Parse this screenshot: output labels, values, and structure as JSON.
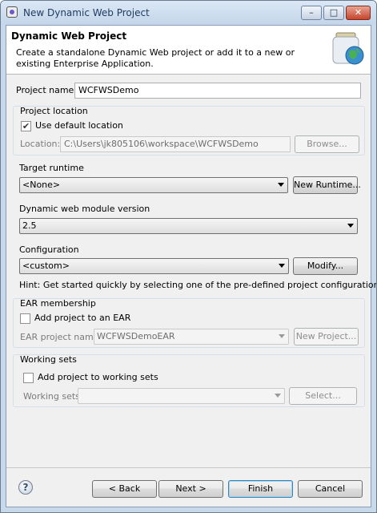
{
  "window": {
    "title": "New Dynamic Web Project"
  },
  "banner": {
    "title": "Dynamic Web Project",
    "description": "Create a standalone Dynamic Web project or add it to a new or existing Enterprise Application."
  },
  "project_name": {
    "label": "Project name:",
    "value": "WCFWSDemo"
  },
  "project_location": {
    "group_label": "Project location",
    "use_default_label": "Use default location",
    "use_default_checked": true,
    "location_label": "Location:",
    "location_value": "C:\\Users\\jk805106\\workspace\\WCFWSDemo",
    "browse_label": "Browse..."
  },
  "target_runtime": {
    "label": "Target runtime",
    "value": "<None>",
    "new_runtime_label": "New Runtime..."
  },
  "module_version": {
    "label": "Dynamic web module version",
    "value": "2.5"
  },
  "configuration": {
    "label": "Configuration",
    "value": "<custom>",
    "modify_label": "Modify...",
    "hint": "Hint: Get started quickly by selecting one of the pre-defined project configurations."
  },
  "ear": {
    "group_label": "EAR membership",
    "add_label": "Add project to an EAR",
    "add_checked": false,
    "project_name_label": "EAR project name:",
    "project_name_value": "WCFWSDemoEAR",
    "new_project_label": "New Project..."
  },
  "working_sets": {
    "group_label": "Working sets",
    "add_label": "Add project to working sets",
    "add_checked": false,
    "label": "Working sets:",
    "value": "",
    "select_label": "Select..."
  },
  "footer": {
    "back_label": "< Back",
    "next_label": "Next >",
    "finish_label": "Finish",
    "cancel_label": "Cancel"
  },
  "icons": {
    "window": "app-icon",
    "help": "help-icon",
    "wizard": "wizard-jar-globe-icon"
  },
  "colors": {
    "titlebar": "#c4d6ea",
    "close_button": "#c7442c",
    "banner_bg": "#ffffff",
    "dialog_bg": "#f0f0f0"
  }
}
